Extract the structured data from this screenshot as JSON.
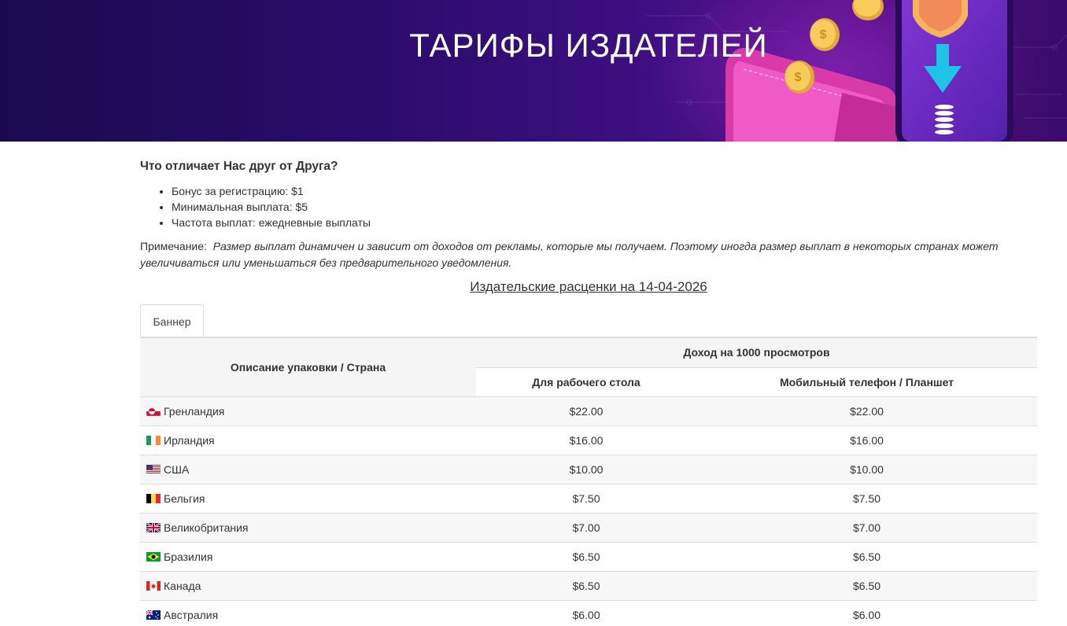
{
  "hero": {
    "title": "ТАРИФЫ ИЗДАТЕЛЕЙ"
  },
  "main": {
    "heading": "Что отличает Нас друг от Друга?",
    "features": [
      "Бонус за регистрацию: $1",
      "Минимальная выплата: $5",
      "Частота выплат: ежедневные выплаты"
    ],
    "note_label": "Примечание:",
    "note_text": "Размер выплат динамичен и зависит от доходов от рекламы, которые мы получаем. Поэтому иногда размер выплат в некоторых странах может увеличиваться или уменьшаться без предварительного уведомления.",
    "rates_title": "Издательские расценки на 14-04-2026"
  },
  "tabs": [
    {
      "label": "Баннер",
      "active": true
    }
  ],
  "table": {
    "col_country": "Описание упаковки / Страна",
    "col_income": "Доход на 1000 просмотров",
    "col_desktop": "Для рабочего стола",
    "col_mobile": "Мобильный телефон / Планшет",
    "rows": [
      {
        "country": "Гренландия",
        "flag": "greenland-flag",
        "desktop": "$22.00",
        "mobile": "$22.00"
      },
      {
        "country": "Ирландия",
        "flag": "ireland-flag",
        "desktop": "$16.00",
        "mobile": "$16.00"
      },
      {
        "country": "США",
        "flag": "usa-flag",
        "desktop": "$10.00",
        "mobile": "$10.00"
      },
      {
        "country": "Бельгия",
        "flag": "belgium-flag",
        "desktop": "$7.50",
        "mobile": "$7.50"
      },
      {
        "country": "Великобритания",
        "flag": "uk-flag",
        "desktop": "$7.00",
        "mobile": "$7.00"
      },
      {
        "country": "Бразилия",
        "flag": "brazil-flag",
        "desktop": "$6.50",
        "mobile": "$6.50"
      },
      {
        "country": "Канада",
        "flag": "canada-flag",
        "desktop": "$6.50",
        "mobile": "$6.50"
      },
      {
        "country": "Австралия",
        "flag": "australia-flag",
        "desktop": "$6.00",
        "mobile": "$6.00"
      }
    ]
  },
  "colors": {
    "hero_dark": "#1a0a4d",
    "hero_purple": "#3d0f80",
    "wallet_pink": "#e83fb5",
    "coin_gold": "#f3c24d",
    "phone_violet": "#6a2cc9",
    "arrow_cyan": "#1fc3e6"
  }
}
